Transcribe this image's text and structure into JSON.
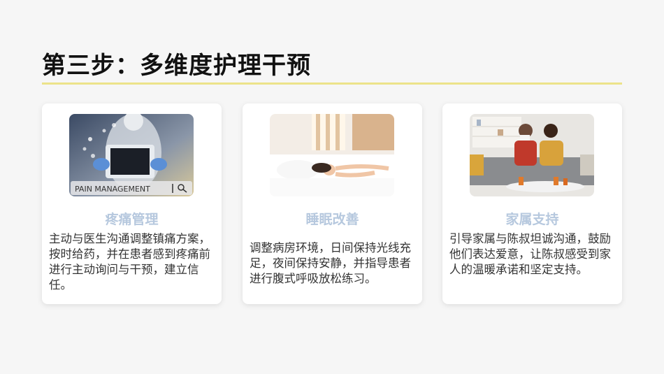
{
  "page": {
    "title": "第三步：多维度护理干预"
  },
  "cards": [
    {
      "title": "疼痛管理",
      "image_caption": "PAIN MANAGEMENT",
      "text": "主动与医生沟通调整镇痛方案，按时给药，并在患者感到疼痛前进行主动询问与干预，建立信任。"
    },
    {
      "title": "睡眠改善",
      "text": "调整病房环境，日间保持光线充足，夜间保持安静，并指导患者进行腹式呼吸放松练习。"
    },
    {
      "title": "家属支持",
      "text": "引导家属与陈叔坦诚沟通，鼓励他们表达爱意，让陈叔感受到家人的温暖承诺和坚定支持。"
    }
  ],
  "colors": {
    "accent_rule": "#ece38a",
    "card_title": "#b6c8de"
  }
}
